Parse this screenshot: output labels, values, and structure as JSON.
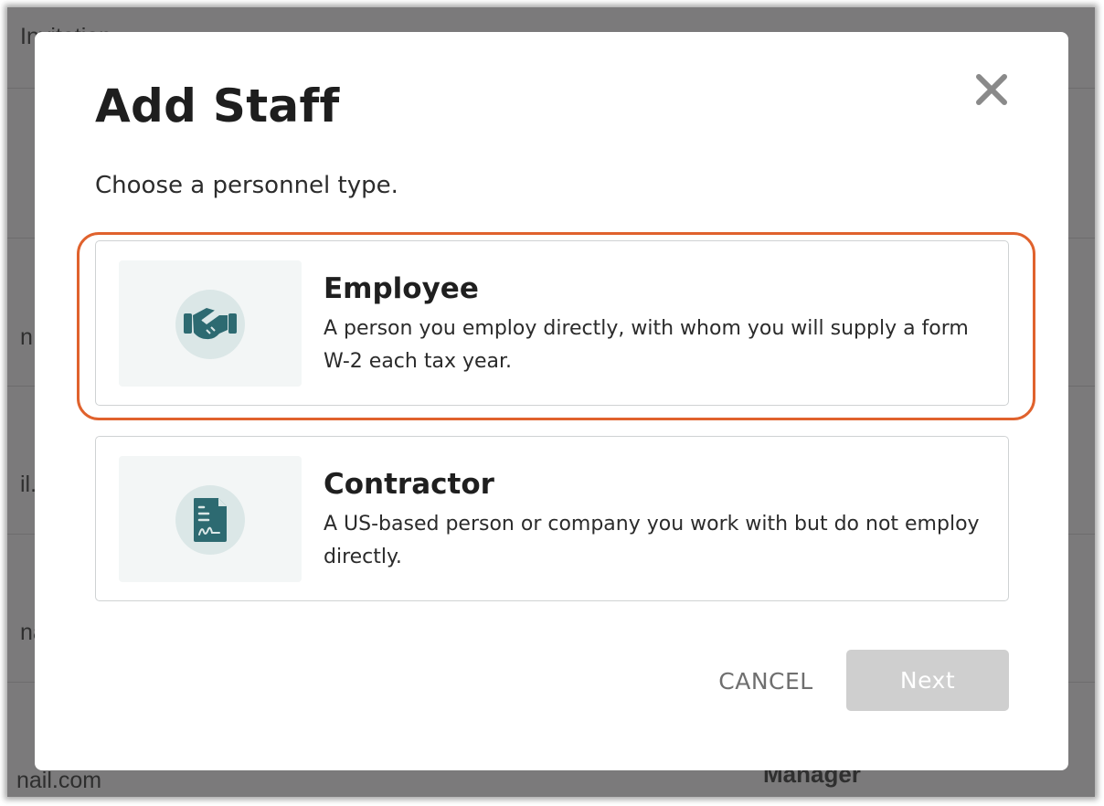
{
  "background": {
    "fragments": [
      "Invitation",
      "n",
      "il.",
      "na",
      "nail.com",
      "Manager"
    ]
  },
  "modal": {
    "title": "Add Staff",
    "close_icon": "close-icon",
    "subtitle": "Choose a personnel type.",
    "options": [
      {
        "title": "Employee",
        "description": "A person you employ directly, with whom you will supply a form W-2 each tax year.",
        "icon": "handshake-icon",
        "highlighted": true
      },
      {
        "title": "Contractor",
        "description": "A US-based person or company you work with but do not employ directly.",
        "icon": "signed-document-icon",
        "highlighted": false
      }
    ],
    "cancel_label": "CANCEL",
    "next_label": "Next",
    "next_enabled": false
  },
  "colors": {
    "highlight": "#e0622d",
    "icon": "#2d6a71",
    "icon_circle": "#dbe7e7",
    "disabled_button": "#cfcfcf",
    "overlay": "#7b7a7b"
  }
}
